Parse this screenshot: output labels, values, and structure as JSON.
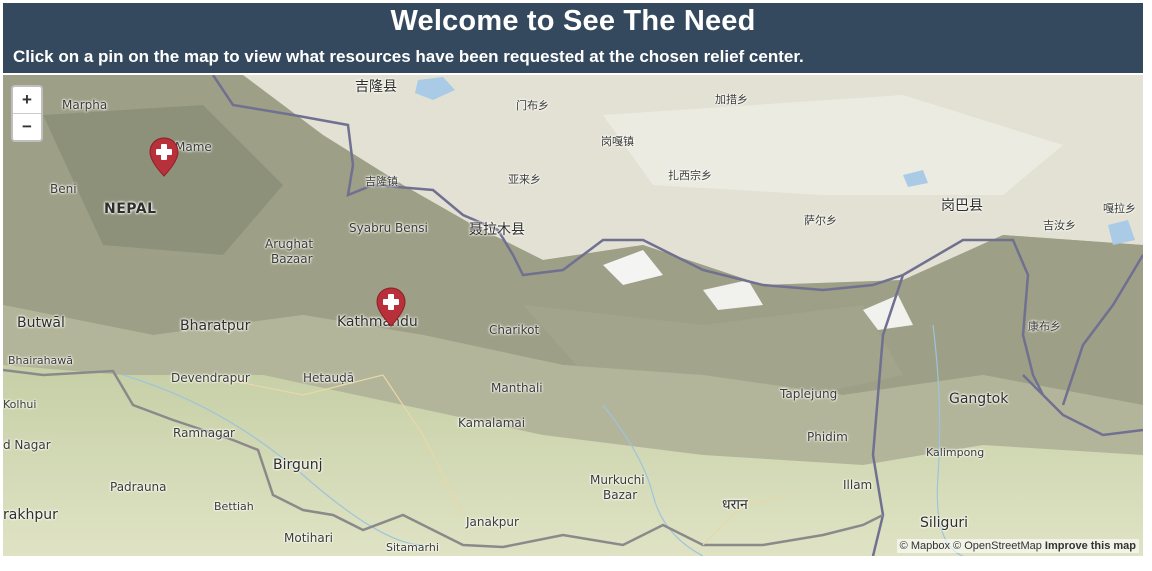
{
  "header": {
    "title": "Welcome to See The Need",
    "subtitle": "Click on a pin on the map to view what resources have been requested at the chosen relief center."
  },
  "map": {
    "zoom_in": "+",
    "zoom_out": "−",
    "labels": [
      "吉隆县",
      "门布乡",
      "加措乡",
      "Marpha",
      "岗嘎镇",
      "Mame",
      "吉隆镇",
      "亚来乡",
      "扎西宗乡",
      "Beni",
      "NEPAL",
      "岗巴县",
      "萨尔乡",
      "吉汝乡",
      "嘎拉乡",
      "Syabru Bensi",
      "聂拉木县",
      "Arughat",
      "Bazaar",
      "Butwāl",
      "Bharatpur",
      "Kathmandu",
      "Charikot",
      "康布乡",
      "Bhairahawā",
      "Devendrapur",
      "Hetauḍā",
      "Manthali",
      "Kolhui",
      "Taplejung",
      "Gangtok",
      "Kamalamai",
      "d Nagar",
      "Ramnagar",
      "Phidim",
      "Birgunj",
      "Kalimpong",
      "Murkuchi",
      "Bazar",
      "Padrauna",
      "Illam",
      "धरान",
      "Bettiah",
      "rakhpur",
      "Janakpur",
      "Siliguri",
      "Motihari",
      "Sitamarhi"
    ],
    "pins": [
      {
        "name": "relief-center-pin",
        "icon": "plus-icon"
      },
      {
        "name": "relief-center-pin",
        "icon": "plus-icon"
      }
    ],
    "attribution": {
      "mapbox": "© Mapbox",
      "osm": "© OpenStreetMap",
      "improve": "Improve this map"
    },
    "colors": {
      "header_bg": "#34495e",
      "pin": "#b7303a"
    }
  }
}
